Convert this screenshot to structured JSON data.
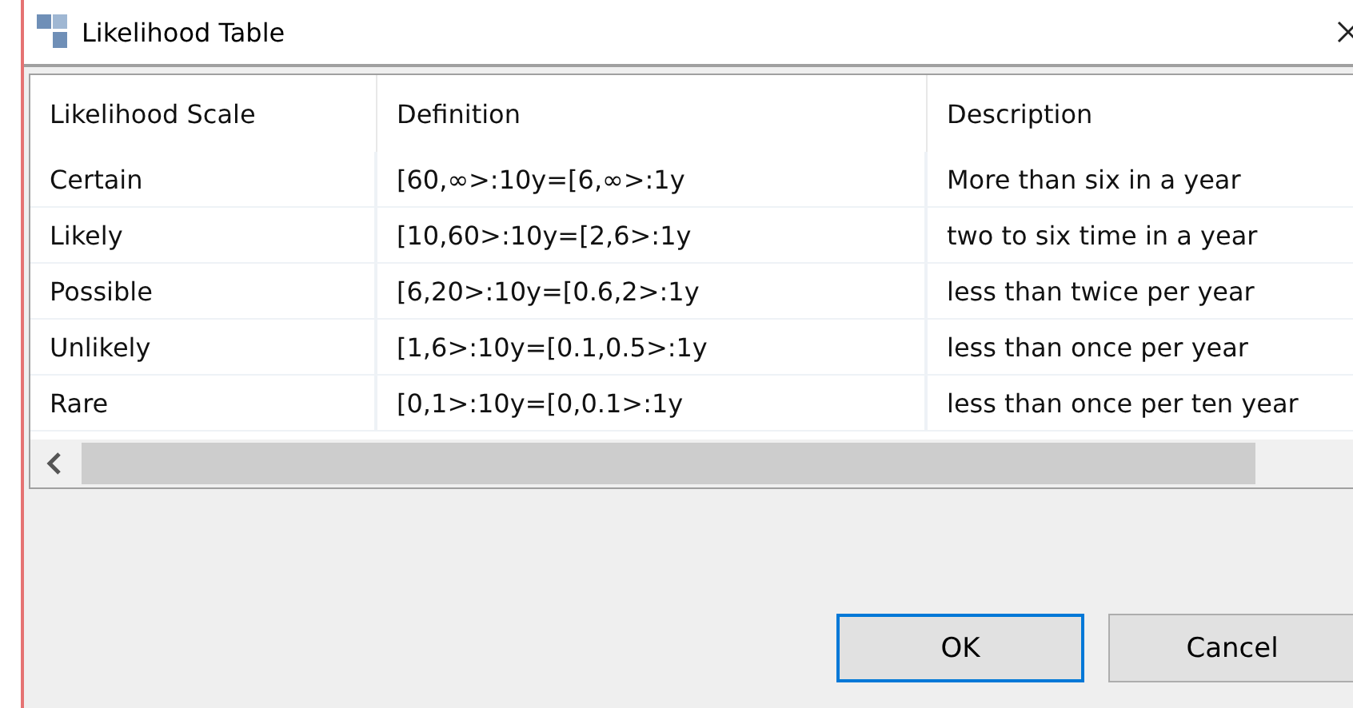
{
  "window": {
    "title": "Likelihood Table"
  },
  "table": {
    "columns": [
      "Likelihood Scale",
      "Definition",
      "Description"
    ],
    "rows": [
      [
        "Certain",
        "[60,∞>:10y=[6,∞>:1y",
        "More than six in a year"
      ],
      [
        "Likely",
        "[10,60>:10y=[2,6>:1y",
        "two to six time in a year"
      ],
      [
        "Possible",
        "[6,20>:10y=[0.6,2>:1y",
        "less than twice per year"
      ],
      [
        "Unlikely",
        "[1,6>:10y=[0.1,0.5>:1y",
        "less than once per year"
      ],
      [
        "Rare",
        "[0,1>:10y=[0,0.1>:1y",
        "less than once per ten year"
      ]
    ]
  },
  "buttons": [
    {
      "label": "OK",
      "default": true
    },
    {
      "label": "Cancel",
      "default": false
    }
  ]
}
